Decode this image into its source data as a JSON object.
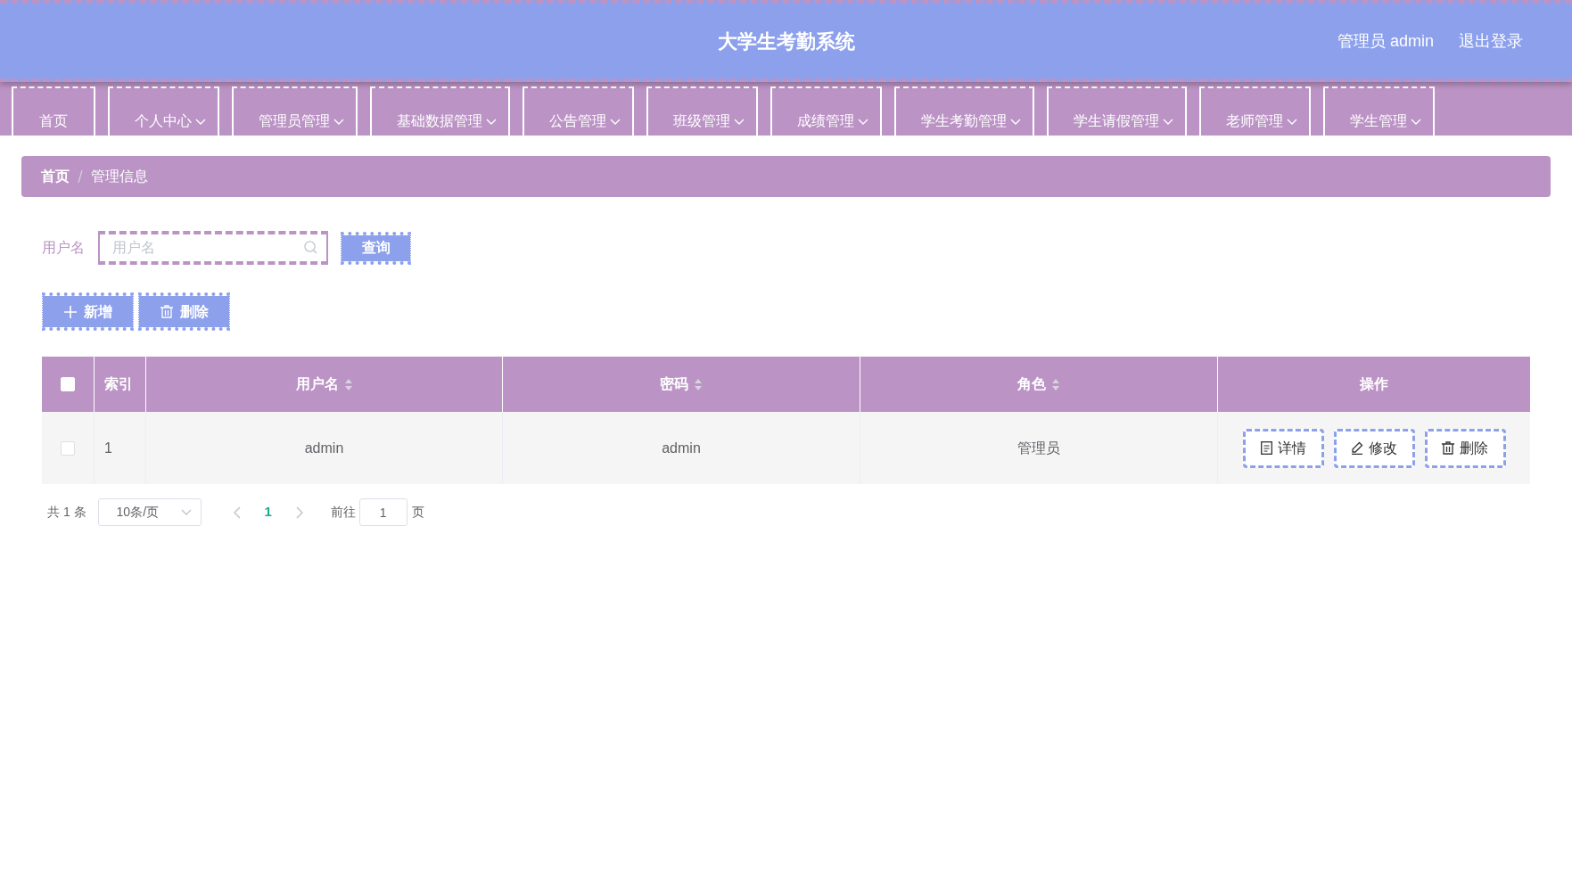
{
  "header": {
    "title": "大学生考勤系统",
    "user_label": "管理员 admin",
    "logout": "退出登录"
  },
  "nav": [
    {
      "label": "首页",
      "dropdown": false
    },
    {
      "label": "个人中心",
      "dropdown": true
    },
    {
      "label": "管理员管理",
      "dropdown": true
    },
    {
      "label": "基础数据管理",
      "dropdown": true
    },
    {
      "label": "公告管理",
      "dropdown": true
    },
    {
      "label": "班级管理",
      "dropdown": true
    },
    {
      "label": "成绩管理",
      "dropdown": true
    },
    {
      "label": "学生考勤管理",
      "dropdown": true
    },
    {
      "label": "学生请假管理",
      "dropdown": true
    },
    {
      "label": "老师管理",
      "dropdown": true
    },
    {
      "label": "学生管理",
      "dropdown": true
    }
  ],
  "breadcrumb": [
    {
      "label": "首页"
    },
    {
      "label": "管理信息"
    }
  ],
  "search": {
    "label": "用户名",
    "placeholder": "用户名",
    "button": "查询"
  },
  "actions": [
    {
      "kind": "add",
      "label": "新增"
    },
    {
      "kind": "delete",
      "label": "删除"
    }
  ],
  "table": {
    "select_all": {
      "checked": false
    },
    "columns": [
      {
        "label": "索引",
        "sortable": false
      },
      {
        "label": "用户名",
        "sortable": true
      },
      {
        "label": "密码",
        "sortable": true
      },
      {
        "label": "角色",
        "sortable": true
      },
      {
        "label": "操作",
        "sortable": false
      }
    ],
    "rows": [
      {
        "checked": false,
        "cells": [
          "1",
          "admin",
          "admin",
          "管理员"
        ],
        "actions": [
          {
            "kind": "detail",
            "label": "详情"
          },
          {
            "kind": "edit",
            "label": "修改"
          },
          {
            "kind": "delete",
            "label": "删除"
          }
        ]
      }
    ]
  },
  "pagination": {
    "total": "共 1 条",
    "page_size": "10条/页",
    "pages": [
      {
        "label": "1",
        "selected": true
      }
    ],
    "goto_label": "前往",
    "goto_value": "1",
    "page_suffix": "页"
  }
}
